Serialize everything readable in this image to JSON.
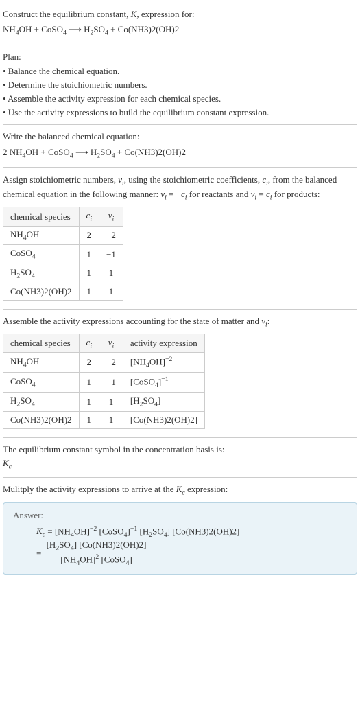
{
  "intro": {
    "title": "Construct the equilibrium constant, K, expression for:",
    "equation": "NH₄OH + CoSO₄ ⟶ H₂SO₄ + Co(NH3)2(OH)2"
  },
  "plan": {
    "heading": "Plan:",
    "items": [
      "• Balance the chemical equation.",
      "• Determine the stoichiometric numbers.",
      "• Assemble the activity expression for each chemical species.",
      "• Use the activity expressions to build the equilibrium constant expression."
    ]
  },
  "balanced": {
    "heading": "Write the balanced chemical equation:",
    "equation": "2 NH₄OH + CoSO₄ ⟶ H₂SO₄ + Co(NH3)2(OH)2"
  },
  "stoich": {
    "heading": "Assign stoichiometric numbers, νᵢ, using the stoichiometric coefficients, cᵢ, from the balanced chemical equation in the following manner: νᵢ = −cᵢ for reactants and νᵢ = cᵢ for products:",
    "headers": [
      "chemical species",
      "cᵢ",
      "νᵢ"
    ],
    "rows": [
      {
        "species": "NH₄OH",
        "c": "2",
        "v": "−2"
      },
      {
        "species": "CoSO₄",
        "c": "1",
        "v": "−1"
      },
      {
        "species": "H₂SO₄",
        "c": "1",
        "v": "1"
      },
      {
        "species": "Co(NH3)2(OH)2",
        "c": "1",
        "v": "1"
      }
    ]
  },
  "activity": {
    "heading": "Assemble the activity expressions accounting for the state of matter and νᵢ:",
    "headers": [
      "chemical species",
      "cᵢ",
      "νᵢ",
      "activity expression"
    ],
    "rows": [
      {
        "species": "NH₄OH",
        "c": "2",
        "v": "−2",
        "expr": "[NH₄OH]⁻²"
      },
      {
        "species": "CoSO₄",
        "c": "1",
        "v": "−1",
        "expr": "[CoSO₄]⁻¹"
      },
      {
        "species": "H₂SO₄",
        "c": "1",
        "v": "1",
        "expr": "[H₂SO₄]"
      },
      {
        "species": "Co(NH3)2(OH)2",
        "c": "1",
        "v": "1",
        "expr": "[Co(NH3)2(OH)2]"
      }
    ]
  },
  "symbol": {
    "heading": "The equilibrium constant symbol in the concentration basis is:",
    "value": "K𝚌"
  },
  "multiply": {
    "heading": "Mulitply the activity expressions to arrive at the K𝚌 expression:"
  },
  "answer": {
    "label": "Answer:",
    "line1_lhs": "K𝚌 = ",
    "line1_rhs": "[NH₄OH]⁻² [CoSO₄]⁻¹ [H₂SO₄] [Co(NH3)2(OH)2]",
    "frac_eq": "= ",
    "frac_num": "[H₂SO₄] [Co(NH3)2(OH)2]",
    "frac_den": "[NH₄OH]² [CoSO₄]"
  }
}
